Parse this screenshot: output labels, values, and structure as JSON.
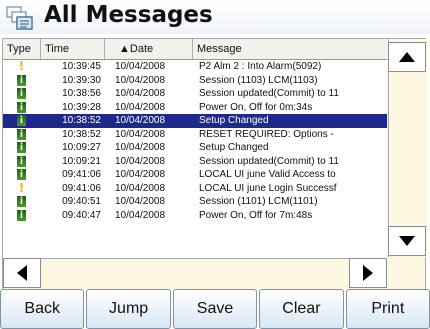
{
  "title": "All Messages",
  "columns": {
    "type": "Type",
    "time": "Time",
    "date": "▲Date",
    "message": "Message"
  },
  "rows": [
    {
      "icon": "warning-icon",
      "time": "10:39:45",
      "date": "10/04/2008",
      "message": "P2 Alm 2 : Into Alarm(5092)"
    },
    {
      "icon": "info-icon",
      "time": "10:39:30",
      "date": "10/04/2008",
      "message": "Session (1103) LCM(1103)"
    },
    {
      "icon": "info-icon",
      "time": "10:38:56",
      "date": "10/04/2008",
      "message": "Session updated(Commit) to 11"
    },
    {
      "icon": "info-icon",
      "time": "10:39:28",
      "date": "10/04/2008",
      "message": "Power On, Off for 0m:34s"
    },
    {
      "icon": "info-icon",
      "time": "10:38:52",
      "date": "10/04/2008",
      "message": "Setup Changed",
      "selected": true
    },
    {
      "icon": "info-icon",
      "time": "10:38:52",
      "date": "10/04/2008",
      "message": "RESET REQUIRED: Options -"
    },
    {
      "icon": "info-icon",
      "time": "10:09:27",
      "date": "10/04/2008",
      "message": "Setup Changed"
    },
    {
      "icon": "info-icon",
      "time": "10:09:21",
      "date": "10/04/2008",
      "message": "Session updated(Commit) to 11"
    },
    {
      "icon": "info-icon",
      "time": "09:41:06",
      "date": "10/04/2008",
      "message": "LOCAL UI june Valid Access to"
    },
    {
      "icon": "warning-icon",
      "time": "09:41:06",
      "date": "10/04/2008",
      "message": "LOCAL UI june Login Successf"
    },
    {
      "icon": "info-icon",
      "time": "09:40:51",
      "date": "10/04/2008",
      "message": "Session (1101) LCM(1101)"
    },
    {
      "icon": "info-icon",
      "time": "09:40:47",
      "date": "10/04/2008",
      "message": "Power On, Off for 7m:48s"
    }
  ],
  "buttons": {
    "back": "Back",
    "jump": "Jump",
    "save": "Save",
    "clear": "Clear",
    "print": "Print"
  },
  "icons": {
    "logo": "messages-logo-icon",
    "scroll_up": "arrow-up-icon",
    "scroll_down": "arrow-down-icon",
    "scroll_left": "arrow-left-icon",
    "scroll_right": "arrow-right-icon"
  },
  "colors": {
    "selection": "#1d2a8c",
    "info_icon": "#2e7d1a",
    "warning_icon": "#e6b800",
    "scroll_track": "#fbf7e1"
  }
}
